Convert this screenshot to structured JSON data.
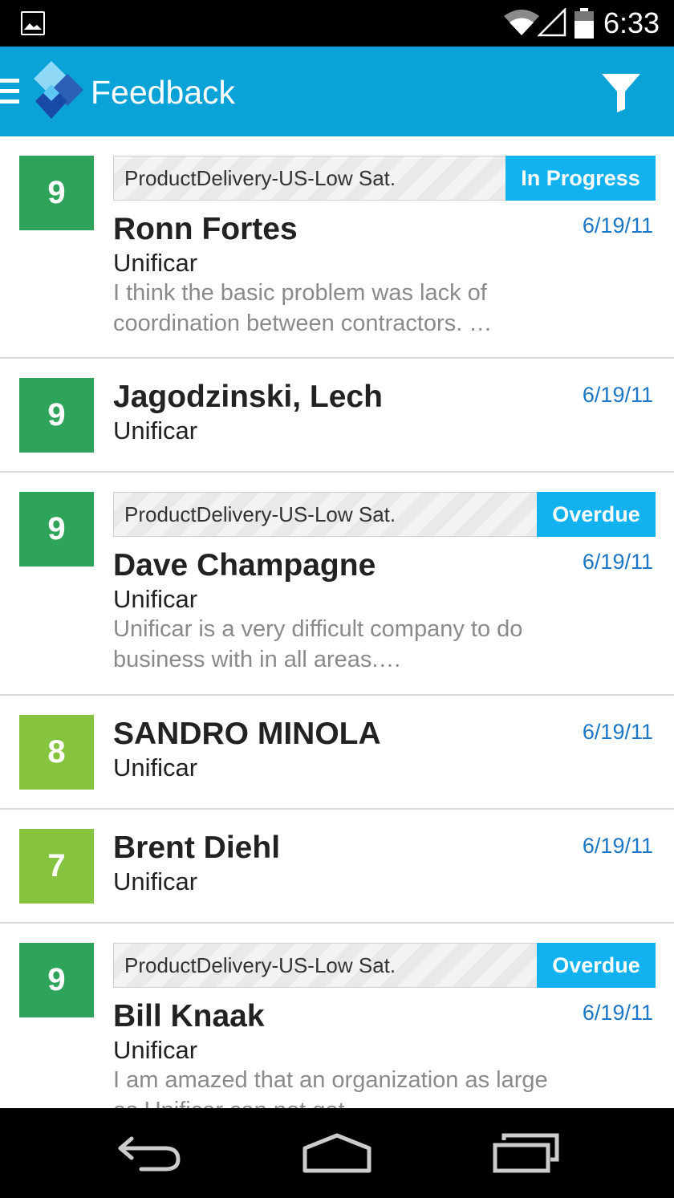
{
  "status_bar": {
    "time": "6:33",
    "icons": [
      "gallery-icon",
      "wifi-icon",
      "signal-icon",
      "battery-icon"
    ]
  },
  "app_bar": {
    "title": "Feedback",
    "icons": [
      "menu-icon",
      "app-logo-icon",
      "filter-icon"
    ],
    "color": "#0ba2d8"
  },
  "colors": {
    "score_high": "#2ea35a",
    "score_mid": "#86c440",
    "status_badge": "#12b1ef",
    "date": "#1b76c6"
  },
  "feedback": [
    {
      "score": "9",
      "tag": "ProductDelivery-US-Low Sat.",
      "status": "In Progress",
      "name": "Ronn Fortes",
      "company": "Unificar",
      "date": "6/19/11",
      "comment_line1": "I think the basic problem was lack of",
      "comment_line2": "coordination between contractors. …"
    },
    {
      "score": "9",
      "name": "Jagodzinski, Lech",
      "company": "Unificar",
      "date": "6/19/11"
    },
    {
      "score": "9",
      "tag": "ProductDelivery-US-Low Sat.",
      "status": "Overdue",
      "name": "Dave Champagne",
      "company": "Unificar",
      "date": "6/19/11",
      "comment_line1": "Unificar is a very difficult company to do",
      "comment_line2": "business with in all areas.…"
    },
    {
      "score": "8",
      "name": "SANDRO MINOLA",
      "company": "Unificar",
      "date": "6/19/11"
    },
    {
      "score": "7",
      "name": "Brent Diehl",
      "company": "Unificar",
      "date": "6/19/11"
    },
    {
      "score": "9",
      "tag": "ProductDelivery-US-Low Sat.",
      "status": "Overdue",
      "name": "Bill Knaak",
      "company": "Unificar",
      "date": "6/19/11",
      "comment_line1": "I am amazed that an organization as large",
      "comment_line2": "as Unificar can not get"
    }
  ],
  "nav_bar": {
    "icons": [
      "back-icon",
      "home-icon",
      "recents-icon"
    ]
  }
}
